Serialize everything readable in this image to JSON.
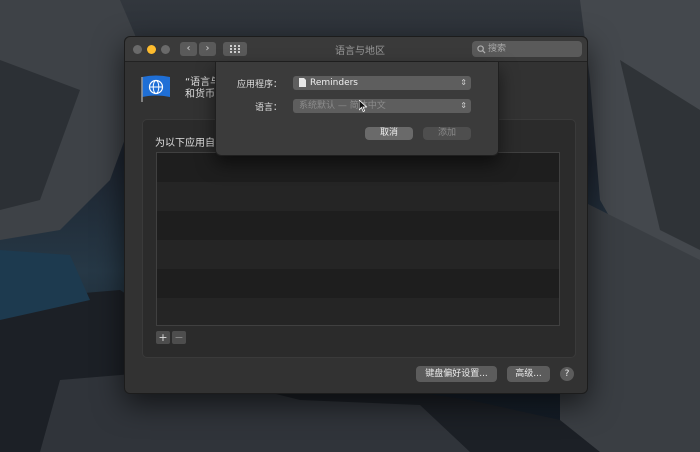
{
  "window": {
    "title": "语言与地区",
    "search_placeholder": "搜索",
    "nav_back": "‹",
    "nav_forward": "›",
    "grid_icon": "grid-icon"
  },
  "header": {
    "line1": "“语言与",
    "line2": "和货币"
  },
  "apps_group": {
    "label": "为以下应用自定",
    "add": "+",
    "remove": "−"
  },
  "buttons": {
    "keyboard_prefs": "键盘偏好设置...",
    "advanced": "高级...",
    "help": "?"
  },
  "sheet": {
    "app_label": "应用程序：",
    "app_value": "Reminders",
    "language_label": "语言：",
    "language_value": "系统默认 — 简体中文",
    "cancel": "取消",
    "add": "添加"
  },
  "colors": {
    "close": "#ff5f57",
    "minimize": "#febc2e",
    "zoom": "#5f5f5f",
    "flag_blue": "#1f6fd6"
  }
}
